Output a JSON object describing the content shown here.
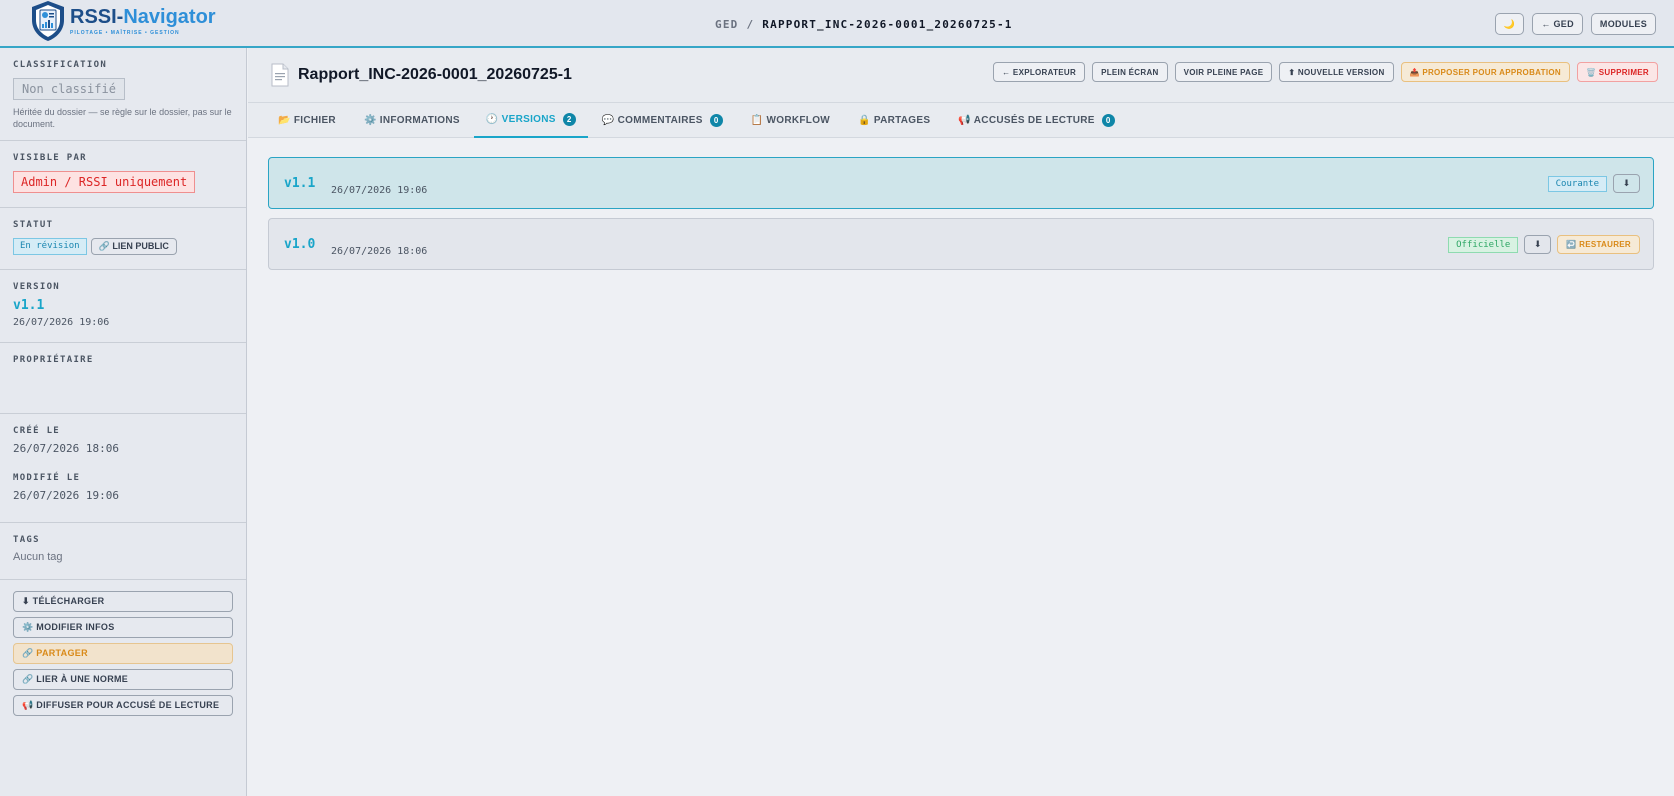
{
  "brand": {
    "name_dark": "RSSI-",
    "name_accent": "Navigator",
    "tagline": "PILOTAGE • MAÎTRISE • GESTION"
  },
  "breadcrumb": {
    "root": "GED",
    "separator": "/",
    "current": "RAPPORT_INC-2026-0001_20260725-1"
  },
  "topbar": {
    "theme_icon": "🌙",
    "back_label": "← GED",
    "modules_label": "MODULES"
  },
  "sidebar": {
    "classification": {
      "label": "CLASSIFICATION",
      "value": "Non classifié",
      "note": "Héritée du dossier — se règle sur le dossier, pas sur le document."
    },
    "visible": {
      "label": "VISIBLE PAR",
      "value": "Admin / RSSI uniquement"
    },
    "status": {
      "label": "STATUT",
      "value": "En révision",
      "public_link": "🔗 LIEN PUBLIC"
    },
    "version": {
      "label": "VERSION",
      "value": "v1.1",
      "date": "26/07/2026 19:06"
    },
    "owner": {
      "label": "PROPRIÉTAIRE"
    },
    "created": {
      "label": "CRÉÉ LE",
      "value": "26/07/2026 18:06"
    },
    "modified": {
      "label": "MODIFIÉ LE",
      "value": "26/07/2026 19:06"
    },
    "tags": {
      "label": "TAGS",
      "value": "Aucun tag"
    },
    "actions": {
      "download": "⬇ TÉLÉCHARGER",
      "edit": "⚙️ MODIFIER INFOS",
      "share": "🔗 PARTAGER",
      "link_norm": "🔗 LIER À UNE NORME",
      "broadcast": "📢 DIFFUSER POUR ACCUSÉ DE LECTURE"
    }
  },
  "document": {
    "icon": "📄",
    "title": "Rapport_INC-2026-0001_20260725-1",
    "actions": {
      "explorer": "← EXPLORATEUR",
      "fullscreen": "PLEIN ÉCRAN",
      "fullpage": "VOIR PLEINE PAGE",
      "new_version": "⬆ NOUVELLE VERSION",
      "propose": "📤 PROPOSER POUR APPROBATION",
      "delete": "🗑️ SUPPRIMER"
    }
  },
  "tabs": {
    "file": "📂 FICHIER",
    "info": "⚙️ INFORMATIONS",
    "versions": "🕐 VERSIONS",
    "versions_count": "2",
    "comments": "💬 COMMENTAIRES",
    "comments_count": "0",
    "workflow": "📋 WORKFLOW",
    "shares": "🔒 PARTAGES",
    "receipts": "📢 ACCUSÉS DE LECTURE",
    "receipts_count": "0"
  },
  "versions": [
    {
      "label": "v1.1",
      "date": "26/07/2026 19:06",
      "badge": "Courante",
      "download": "⬇"
    },
    {
      "label": "v1.0",
      "date": "26/07/2026 18:06",
      "badge": "Officielle",
      "download": "⬇",
      "restore": "↩️ RESTAURER"
    }
  ]
}
